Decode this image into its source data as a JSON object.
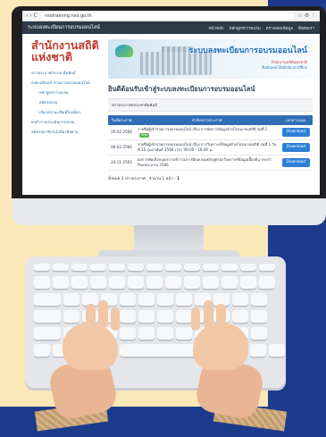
{
  "browser": {
    "address": "nsotraining.nso.go.th",
    "nav_glyphs": "‹ ›  C",
    "ext_glyphs": "☆ ⚙ ⋮"
  },
  "site": {
    "brand": "ระบบลงทะเบียนการอบรมออนไลน์",
    "menu": [
      "หน้าหลัก",
      "หลักสูตรการอบรม",
      "ตรวจสอบข้อมูล",
      "ติดต่อเรา"
    ]
  },
  "sidebar": {
    "org_line1": "สำนักงานสถิติ",
    "org_line2": "แห่งชาติ",
    "links": [
      {
        "label": "ข่าวประกาศ/ประชาสัมพันธ์",
        "sub": false
      },
      {
        "label": "ลงทะเบียนเข้าร่วมการอบรมออนไลน์",
        "sub": false
      },
      {
        "label": "- หลักสูตรการอบรม",
        "sub": true
      },
      {
        "label": "- สมัครอบรม",
        "sub": true
      },
      {
        "label": "- เลือกสถานะ/พิมพ์ใบสมัคร",
        "sub": true
      },
      {
        "label": "ผลสำรวจประเมินการอบรม",
        "sub": false
      },
      {
        "label": "สมัครสมาชิก/แจ้งลืมรหัสผ่าน",
        "sub": false
      }
    ]
  },
  "banner": {
    "title": "ระบบลงทะเบียนการอบรมออนไลน์",
    "sub1": "สำนักงานสถิติแห่งชาติ",
    "sub2": "National Statistical Office"
  },
  "main": {
    "title": "ยินดีต้อนรับเข้าสู่ระบบลงทะเบียนการอบรมออนไลน์",
    "section_label": "ข่าวประกาศ/ประชาสัมพันธ์",
    "table": {
      "headers": [
        "วันที่ประกาศ",
        "หัวข้อข่าวประกาศ",
        "เอกสารแนบ"
      ],
      "rows": [
        {
          "date": "26-02-2566",
          "text": "รายชื่อผู้เข้าร่วมการอบรมออนไลน์ เรื่อง การจัดการข้อมูลด้วยโปรแกรมสถิติ รุ่นที่ 1",
          "badge": "new",
          "download": "Download"
        },
        {
          "date": "06-02-2566",
          "text": "รายชื่อผู้เข้าร่วมการอบรมออนไลน์ เรื่อง การวิเคราะห์ข้อมูลด้วยโปรแกรมสถิติ รุ่นที่ 1 วันที่ 15 กุมภาพันธ์ 2566 เวลา 09.00 - 16.00 น.",
          "badge": "",
          "download": "Download"
        },
        {
          "date": "20-11-2565",
          "text": "ผลการคัดเลือกบุคลากรเข้าร่วมการฝึกอบรมหลักสูตรนักวิเคราะห์ข้อมูลเบื้องต้น ประจำปีงบประมาณ 2566",
          "badge": "",
          "download": "Download"
        }
      ]
    },
    "pager_prefix": "ทั้งหมด 3 ข่าวประกาศ : จำนวน 1 หน้า :",
    "pager_page": "1"
  }
}
